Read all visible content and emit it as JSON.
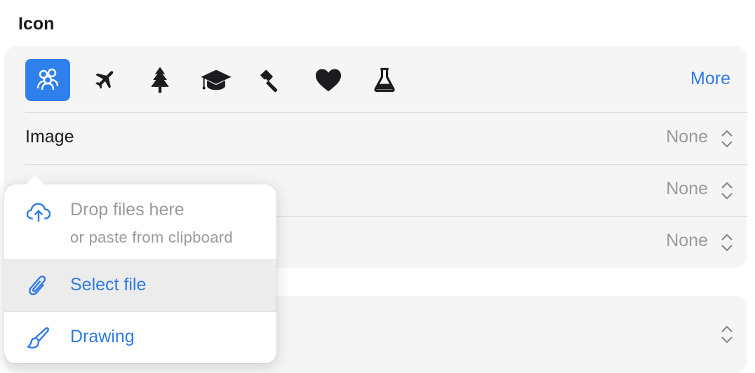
{
  "section": {
    "title": "Icon"
  },
  "icon_picker": {
    "icons": [
      {
        "name": "people-icon",
        "selected": true
      },
      {
        "name": "airplane-icon",
        "selected": false
      },
      {
        "name": "tree-icon",
        "selected": false
      },
      {
        "name": "graduation-cap-icon",
        "selected": false
      },
      {
        "name": "gavel-icon",
        "selected": false
      },
      {
        "name": "heart-icon",
        "selected": false
      },
      {
        "name": "flask-icon",
        "selected": false
      }
    ],
    "more_label": "More"
  },
  "rows": [
    {
      "label": "Image",
      "value": "None"
    },
    {
      "label": "",
      "value": "None"
    },
    {
      "label": "",
      "value": "None"
    }
  ],
  "popover": {
    "drop_title": "Drop files here",
    "drop_subtitle": "or paste from clipboard",
    "items": [
      {
        "label": "Select file",
        "icon": "paperclip-icon"
      },
      {
        "label": "Drawing",
        "icon": "paintbrush-icon"
      }
    ]
  },
  "colors": {
    "accent": "#2f80ed",
    "link": "#2f7ae5",
    "panel_bg": "#f5f5f5",
    "secondary_text": "#9a9a9e"
  }
}
